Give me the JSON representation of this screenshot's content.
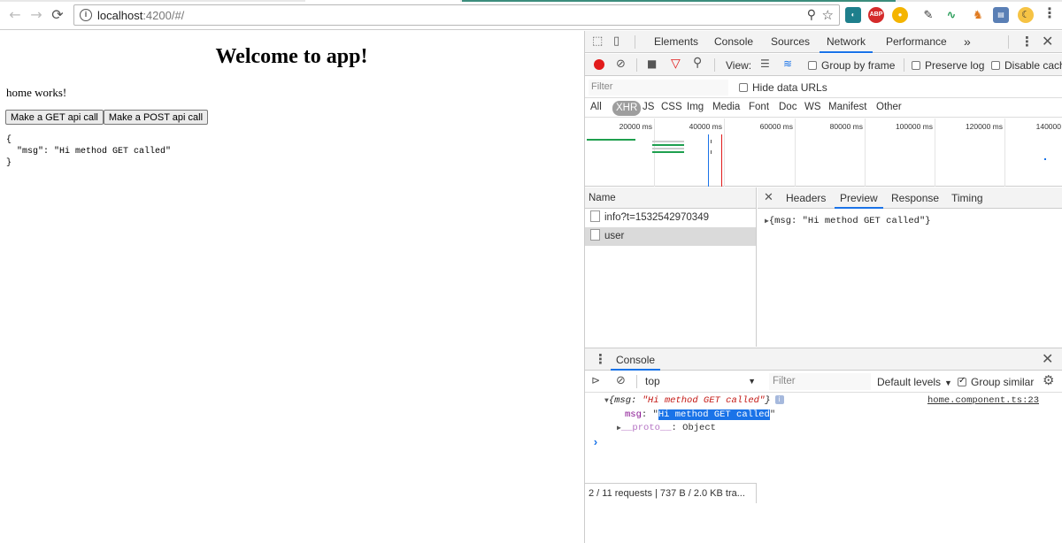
{
  "browser": {
    "url_host": "localhost",
    "url_rest": ":4200/#/",
    "extensions": [
      "Page ruler",
      "ABP",
      "Chrome",
      "Color picker",
      "Analytics",
      "Fox",
      "Monitor",
      "Mode"
    ]
  },
  "page": {
    "title": "Welcome to app!",
    "message": "home works!",
    "get_button": "Make a GET api call",
    "post_button": "Make a POST api call",
    "json_output": "{\n  \"msg\": \"Hi method GET called\"\n}"
  },
  "devtools": {
    "tabs": [
      "Elements",
      "Console",
      "Sources",
      "Network",
      "Performance"
    ],
    "active_tab": "Network",
    "more_tabs": "»",
    "toolbar": {
      "view_label": "View:",
      "group_by_frame": "Group by frame",
      "preserve_log": "Preserve log",
      "disable_cache": "Disable cach"
    },
    "filter_placeholder": "Filter",
    "hide_data_urls": "Hide data URLs",
    "types": [
      "All",
      "XHR",
      "JS",
      "CSS",
      "Img",
      "Media",
      "Font",
      "Doc",
      "WS",
      "Manifest",
      "Other"
    ],
    "active_type": "XHR",
    "timeline_ticks": [
      "20000 ms",
      "40000 ms",
      "60000 ms",
      "80000 ms",
      "100000 ms",
      "120000 ms",
      "140000"
    ],
    "name_header": "Name",
    "requests": [
      {
        "name": "info?t=1532542970349",
        "selected": false
      },
      {
        "name": "user",
        "selected": true
      }
    ],
    "detail_tabs": [
      "Headers",
      "Preview",
      "Response",
      "Timing"
    ],
    "active_detail_tab": "Preview",
    "preview_text": "{msg: \"Hi method GET called\"}",
    "status": "2 / 11 requests  |  737 B / 2.0 KB tra..."
  },
  "console": {
    "drawer_tab": "Console",
    "context": "top",
    "filter_placeholder": "Filter",
    "levels": "Default levels",
    "group_similar": "Group similar",
    "log_object": "{msg: \"Hi method GET called\"}",
    "source": "home.component.ts:23",
    "prop_key": "msg",
    "prop_value": "Hi method GET called",
    "proto_key": "__proto__",
    "proto_value": "Object",
    "prompt": "›"
  }
}
